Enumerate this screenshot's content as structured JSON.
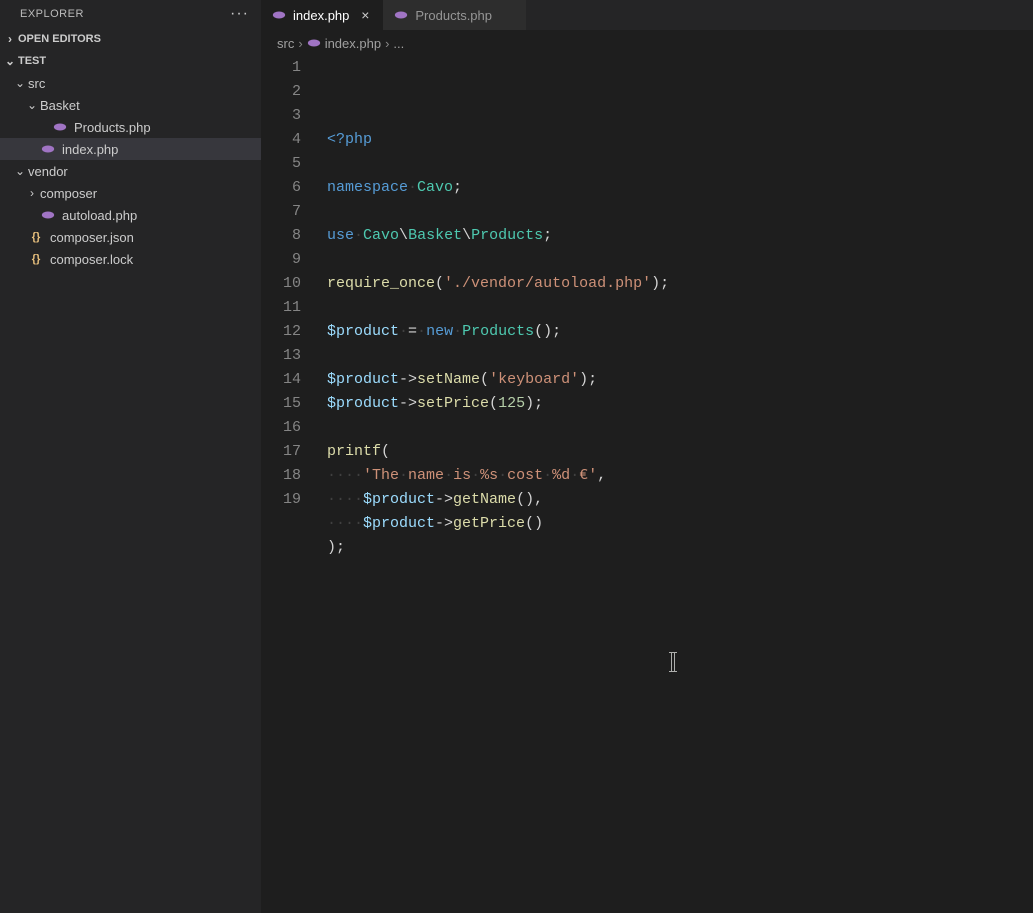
{
  "explorer": {
    "title": "EXPLORER",
    "open_editors": "OPEN EDITORS",
    "workspace": "TEST",
    "tree": [
      {
        "label": "src",
        "type": "folder",
        "indent": 1,
        "expanded": true
      },
      {
        "label": "Basket",
        "type": "folder",
        "indent": 2,
        "expanded": true
      },
      {
        "label": "Products.php",
        "type": "php",
        "indent": 3,
        "selected": false
      },
      {
        "label": "index.php",
        "type": "php",
        "indent": 2,
        "selected": true
      },
      {
        "label": "vendor",
        "type": "folder",
        "indent": 1,
        "expanded": true
      },
      {
        "label": "composer",
        "type": "folder",
        "indent": 2,
        "expanded": false
      },
      {
        "label": "autoload.php",
        "type": "php",
        "indent": 2,
        "selected": false
      },
      {
        "label": "composer.json",
        "type": "json",
        "indent": 1,
        "selected": false
      },
      {
        "label": "composer.lock",
        "type": "json",
        "indent": 1,
        "selected": false
      }
    ]
  },
  "tabs": [
    {
      "label": "index.php",
      "type": "php",
      "active": true,
      "dirty": false
    },
    {
      "label": "Products.php",
      "type": "php",
      "active": false,
      "dirty": false
    }
  ],
  "breadcrumbs": {
    "parts": [
      {
        "label": "src",
        "icon": null
      },
      {
        "label": "index.php",
        "icon": "php"
      },
      {
        "label": "...",
        "icon": null
      }
    ]
  },
  "code": {
    "lines": [
      [
        {
          "t": "<?php",
          "c": "tok-tag"
        }
      ],
      [],
      [
        {
          "t": "namespace",
          "c": "tok-kw"
        },
        {
          "t": "·",
          "c": "tok-ws"
        },
        {
          "t": "Cavo",
          "c": "tok-ns"
        },
        {
          "t": ";",
          "c": "tok-punc"
        }
      ],
      [],
      [
        {
          "t": "use",
          "c": "tok-kw"
        },
        {
          "t": "·",
          "c": "tok-ws"
        },
        {
          "t": "Cavo",
          "c": "tok-ns"
        },
        {
          "t": "\\",
          "c": "tok-punc"
        },
        {
          "t": "Basket",
          "c": "tok-ns"
        },
        {
          "t": "\\",
          "c": "tok-punc"
        },
        {
          "t": "Products",
          "c": "tok-ns"
        },
        {
          "t": ";",
          "c": "tok-punc"
        }
      ],
      [],
      [
        {
          "t": "require_once",
          "c": "tok-fn"
        },
        {
          "t": "(",
          "c": "tok-punc"
        },
        {
          "t": "'./vendor/autoload.php'",
          "c": "tok-str"
        },
        {
          "t": ");",
          "c": "tok-punc"
        }
      ],
      [],
      [
        {
          "t": "$product",
          "c": "tok-var"
        },
        {
          "t": "·",
          "c": "tok-ws"
        },
        {
          "t": "=",
          "c": "tok-op"
        },
        {
          "t": "·",
          "c": "tok-ws"
        },
        {
          "t": "new",
          "c": "tok-new"
        },
        {
          "t": "·",
          "c": "tok-ws"
        },
        {
          "t": "Products",
          "c": "tok-ns"
        },
        {
          "t": "();",
          "c": "tok-punc"
        }
      ],
      [],
      [
        {
          "t": "$product",
          "c": "tok-var"
        },
        {
          "t": "->",
          "c": "tok-op"
        },
        {
          "t": "setName",
          "c": "tok-fn"
        },
        {
          "t": "(",
          "c": "tok-punc"
        },
        {
          "t": "'keyboard'",
          "c": "tok-str"
        },
        {
          "t": ");",
          "c": "tok-punc"
        }
      ],
      [
        {
          "t": "$product",
          "c": "tok-var"
        },
        {
          "t": "->",
          "c": "tok-op"
        },
        {
          "t": "setPrice",
          "c": "tok-fn"
        },
        {
          "t": "(",
          "c": "tok-punc"
        },
        {
          "t": "125",
          "c": "tok-num"
        },
        {
          "t": ");",
          "c": "tok-punc"
        }
      ],
      [],
      [
        {
          "t": "printf",
          "c": "tok-fn"
        },
        {
          "t": "(",
          "c": "tok-punc"
        }
      ],
      [
        {
          "t": "····",
          "c": "tok-ws"
        },
        {
          "t": "'The",
          "c": "tok-str"
        },
        {
          "t": "·",
          "c": "tok-ws"
        },
        {
          "t": "name",
          "c": "tok-str"
        },
        {
          "t": "·",
          "c": "tok-ws"
        },
        {
          "t": "is",
          "c": "tok-str"
        },
        {
          "t": "·",
          "c": "tok-ws"
        },
        {
          "t": "%s",
          "c": "tok-str"
        },
        {
          "t": "·",
          "c": "tok-ws"
        },
        {
          "t": "cost",
          "c": "tok-str"
        },
        {
          "t": "·",
          "c": "tok-ws"
        },
        {
          "t": "%d",
          "c": "tok-str"
        },
        {
          "t": "·",
          "c": "tok-ws"
        },
        {
          "t": "€'",
          "c": "tok-str"
        },
        {
          "t": ",",
          "c": "tok-punc"
        }
      ],
      [
        {
          "t": "····",
          "c": "tok-ws"
        },
        {
          "t": "$product",
          "c": "tok-var"
        },
        {
          "t": "->",
          "c": "tok-op"
        },
        {
          "t": "getName",
          "c": "tok-fn"
        },
        {
          "t": "(),",
          "c": "tok-punc"
        }
      ],
      [
        {
          "t": "····",
          "c": "tok-ws"
        },
        {
          "t": "$product",
          "c": "tok-var"
        },
        {
          "t": "->",
          "c": "tok-op"
        },
        {
          "t": "getPrice",
          "c": "tok-fn"
        },
        {
          "t": "()",
          "c": "tok-punc"
        }
      ],
      [
        {
          "t": ");",
          "c": "tok-punc"
        }
      ],
      []
    ]
  }
}
